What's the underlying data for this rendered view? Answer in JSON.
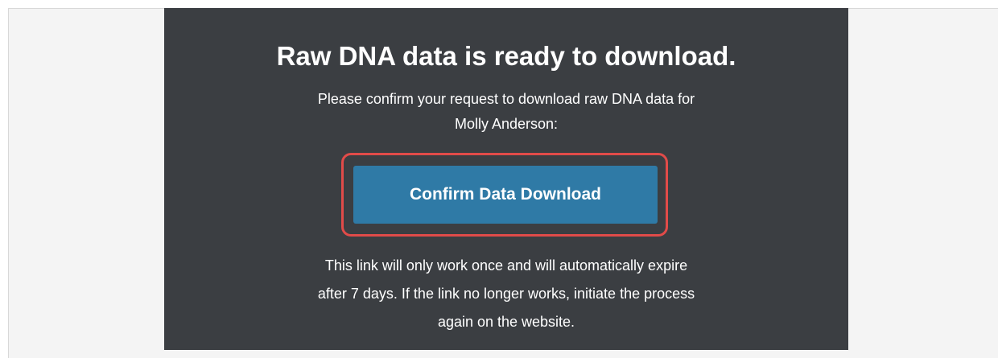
{
  "email": {
    "headline": "Raw DNA data is ready to download.",
    "intro_lines": [
      "Please confirm your request to download raw DNA data for",
      "Molly Anderson:"
    ],
    "confirm_button_label": "Confirm Data Download",
    "note_lines": [
      "This link will only work once and will automatically expire",
      "after 7 days. If the link no longer works, initiate the process",
      "again on the website."
    ]
  },
  "colors": {
    "panel_background": "#3b3e42",
    "button_background": "#2f7aa6",
    "highlight_ring": "#e14b49",
    "page_background": "#f4f4f4"
  }
}
